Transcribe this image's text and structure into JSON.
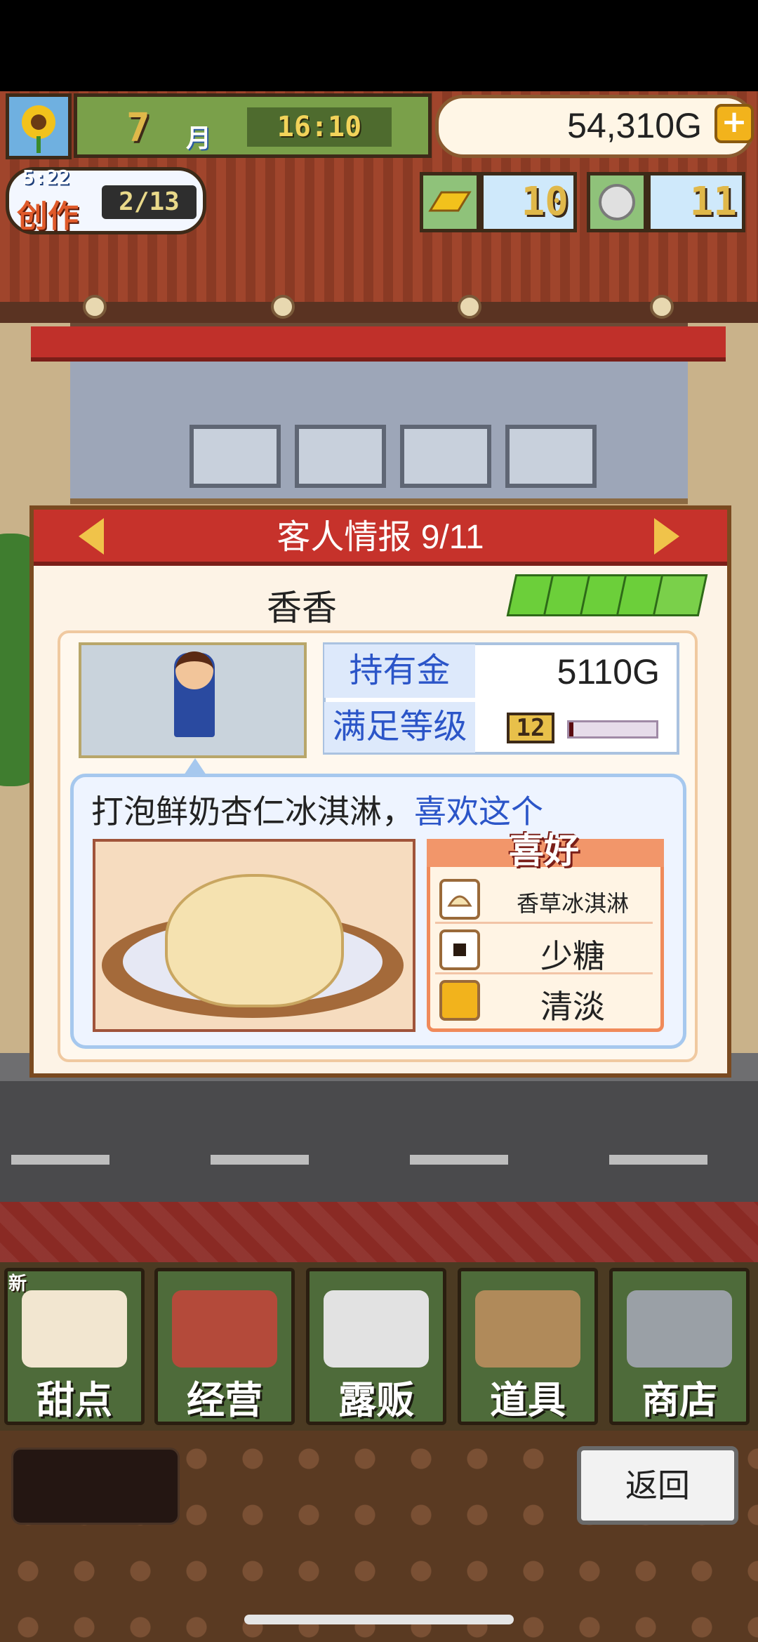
{
  "hud": {
    "month_number": "7",
    "month_unit": "月",
    "time": "16:10",
    "gold": "54,310G",
    "gold_add": "+",
    "craft_timer": "5:22",
    "craft_label": "创作",
    "craft_count": "2/13",
    "gold_bars": "10",
    "coins": "11"
  },
  "panel": {
    "title": "客人情报 9/11",
    "customer_name": "香香",
    "money_label": "持有金",
    "money_value": "5110G",
    "satisfaction_label": "满足等级",
    "satisfaction_level": "12",
    "satisfaction_fill": 0.05,
    "speech_item": "打泡鲜奶杏仁冰淇淋，",
    "speech_like": "喜欢这个",
    "preferences_title": "喜好",
    "preferences": [
      {
        "icon": "ice-cream-icon",
        "label": "香草冰淇淋"
      },
      {
        "icon": "square-icon",
        "label": "少糖"
      },
      {
        "icon": "block-icon",
        "label": "清淡"
      }
    ]
  },
  "menu": {
    "new_badge": "新",
    "items": [
      {
        "label": "甜点",
        "icon": "cake-icon"
      },
      {
        "label": "经营",
        "icon": "shop-icon"
      },
      {
        "label": "露贩",
        "icon": "truck-icon"
      },
      {
        "label": "道具",
        "icon": "tools-icon"
      },
      {
        "label": "商店",
        "icon": "cart-icon"
      }
    ],
    "back_label": "返回"
  },
  "colors": {
    "header_red": "#c6322b",
    "accent_blue": "#2b55c8",
    "menu_green": "#4e6b3a"
  }
}
